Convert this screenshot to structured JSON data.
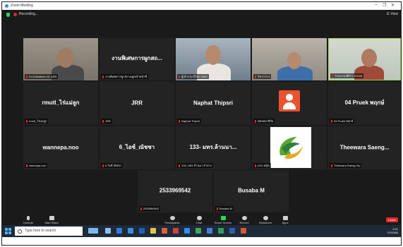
{
  "window": {
    "title": "Zoom Meeting",
    "controls": [
      "–",
      "❐",
      "✕"
    ]
  },
  "meeting": {
    "recording_label": "Recording...",
    "view_label": "☰ View"
  },
  "tiles": [
    {
      "label": "Dr.Oothaikorn M. ASR"
    },
    {
      "name": "งานพิเศษการผูกสถ...",
      "label": "งานพิเศษการผูกสถานทูตเจ้าหน้าที่"
    },
    {
      "label": "ผู้เข้าร่วม ปีใหม่ 2566"
    },
    {
      "label": "วิชาการ 3"
    },
    {
      "label": "โปรแกรมพิธีกร ZOOM"
    },
    {
      "name": "rmutl_ไร่แม่ลูก",
      "label": "rmutl_ไร่แม่ลูก"
    },
    {
      "name": "JRR",
      "label": "JRR"
    },
    {
      "name": "Naphat Thipsri",
      "label": "Naphat Thipsri"
    },
    {
      "label": "พหลพลาธิกิจ"
    },
    {
      "name": "04 Pruek พฤกษ์",
      "label": "04 Pruek พฤกษ์"
    },
    {
      "name": "wannepa.noo",
      "label": "wannepa.noo"
    },
    {
      "name": "6_ไอซ์_ณัชชา",
      "label": "6 ไอซ์ ณัชชา"
    },
    {
      "name": "133- มทร.ล้านนา...",
      "label": "133- มทร.ล้านนา ลำปาง"
    },
    {
      "label": "มรภ.หญิง"
    },
    {
      "name": "Theewara Saeng...",
      "label": "Theewara Saeng-Yip"
    },
    {
      "name": "2533969542",
      "label": "2533969542"
    },
    {
      "name": "Busaba M",
      "label": "Busaba M"
    }
  ],
  "toolbar": {
    "items": [
      {
        "label": "Unmute",
        "icon": "mic-off-icon"
      },
      {
        "label": "Start Video",
        "icon": "video-off-icon"
      },
      {
        "label": "Participants",
        "icon": "participants-icon"
      },
      {
        "label": "Chat",
        "icon": "chat-icon"
      },
      {
        "label": "Share Screen",
        "icon": "share-screen-icon"
      },
      {
        "label": "Record",
        "icon": "record-icon"
      },
      {
        "label": "Reactions",
        "icon": "reactions-icon"
      },
      {
        "label": "Apps",
        "icon": "apps-icon"
      }
    ],
    "leave_label": "Leave"
  },
  "taskbar": {
    "search_placeholder": "Type here to search",
    "time": "4:01",
    "date": "2/2/2566"
  },
  "colors": {
    "meeting_bg": "#1a1a1a",
    "tile_bg": "#232323",
    "accent_green": "#23d959",
    "leave_red": "#e02828"
  }
}
